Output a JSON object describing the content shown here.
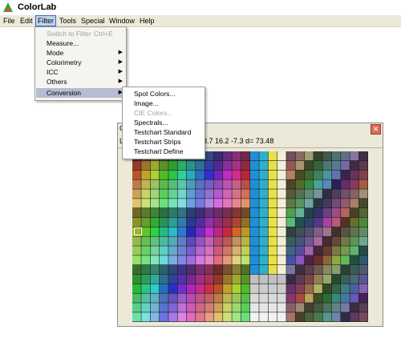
{
  "app": {
    "title": "ColorLab"
  },
  "menubar": [
    {
      "label": "File"
    },
    {
      "label": "Edit"
    },
    {
      "label": "Filter"
    },
    {
      "label": "Tools"
    },
    {
      "label": "Special"
    },
    {
      "label": "Window"
    },
    {
      "label": "Help"
    }
  ],
  "filter_menu": {
    "items": [
      {
        "label": "Switch to Filter",
        "shortcut": "Ctrl+E",
        "disabled": true,
        "submenu": false
      },
      {
        "label": "Measure...",
        "disabled": false,
        "submenu": false
      },
      {
        "label": "Mode",
        "disabled": false,
        "submenu": true
      },
      {
        "label": "Colorimetry",
        "disabled": false,
        "submenu": true
      },
      {
        "label": "ICC",
        "disabled": false,
        "submenu": true
      },
      {
        "label": "Others",
        "disabled": false,
        "submenu": true
      },
      {
        "label": "Conversion",
        "disabled": false,
        "submenu": true,
        "highlighted": true
      }
    ]
  },
  "conversion_submenu": {
    "items": [
      {
        "label": "Spot Colors...",
        "disabled": false
      },
      {
        "label": "Image...",
        "disabled": false
      },
      {
        "label": "CIE Colors...",
        "disabled": true
      },
      {
        "label": "Spectrals...",
        "disabled": false
      },
      {
        "label": "Testchart Standard",
        "disabled": false
      },
      {
        "label": "Testchart Strips",
        "disabled": false
      },
      {
        "label": "Testchart Define",
        "disabled": false
      }
    ]
  },
  "chart_window": {
    "title_fragment": "C",
    "status_label": "L",
    "status_values": "8.7  16.2  -7.3 d= 73.48",
    "close_symbol": "✕"
  },
  "colors": {
    "menu_highlight": "#b6bdd2",
    "menubar": "#ece9d8",
    "close": "#d86b5c"
  }
}
